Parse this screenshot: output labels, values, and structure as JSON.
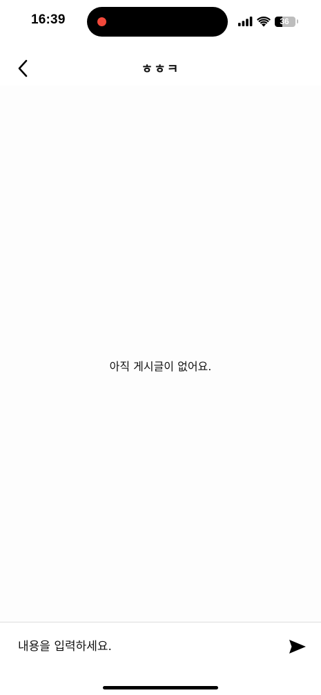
{
  "status_bar": {
    "time": "16:39",
    "battery_level": "36",
    "battery_fraction": 0.36,
    "icons": [
      "signal-icon",
      "wifi-icon",
      "battery-icon"
    ],
    "recording_dot_color": "#f2493b"
  },
  "header": {
    "back_icon": "chevron-left-icon",
    "title": "ㅎㅎㅋ"
  },
  "content": {
    "empty_message": "아직 게시글이 없어요."
  },
  "input_bar": {
    "placeholder": "내용을 입력하세요.",
    "value": "",
    "send_icon": "send-icon"
  }
}
